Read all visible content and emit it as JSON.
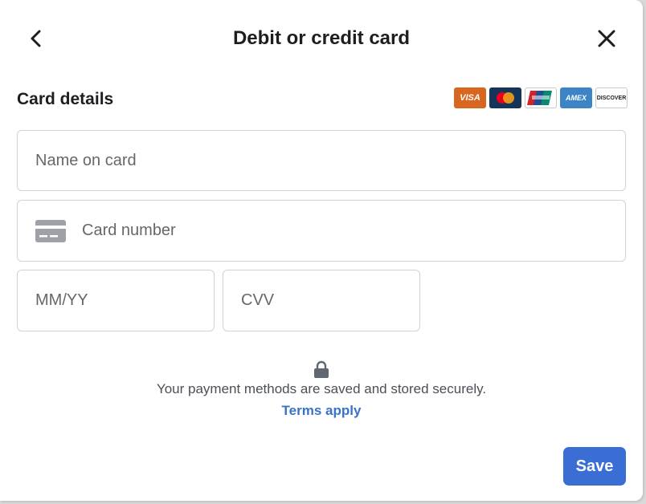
{
  "header": {
    "title": "Debit or credit card",
    "back_icon": "chevron-left-icon",
    "close_icon": "close-icon"
  },
  "card_details": {
    "section_title": "Card details",
    "brand_logos": [
      "VISA",
      "Mastercard",
      "UnionPay",
      "AMEX",
      "DISCOVER"
    ]
  },
  "fields": {
    "name_placeholder": "Name on card",
    "card_number_placeholder": "Card number",
    "expiry_placeholder": "MM/YY",
    "cvv_placeholder": "CVV"
  },
  "security": {
    "icon": "lock-icon",
    "text": "Your payment methods are saved and stored securely.",
    "terms_link": "Terms apply"
  },
  "actions": {
    "save_label": "Save"
  },
  "colors": {
    "primary_button": "#3a6ed5",
    "link": "#3a73c6",
    "visa_logo": "#d9661e",
    "amex_logo": "#3d84c6",
    "mastercard_bg": "#14345a"
  }
}
